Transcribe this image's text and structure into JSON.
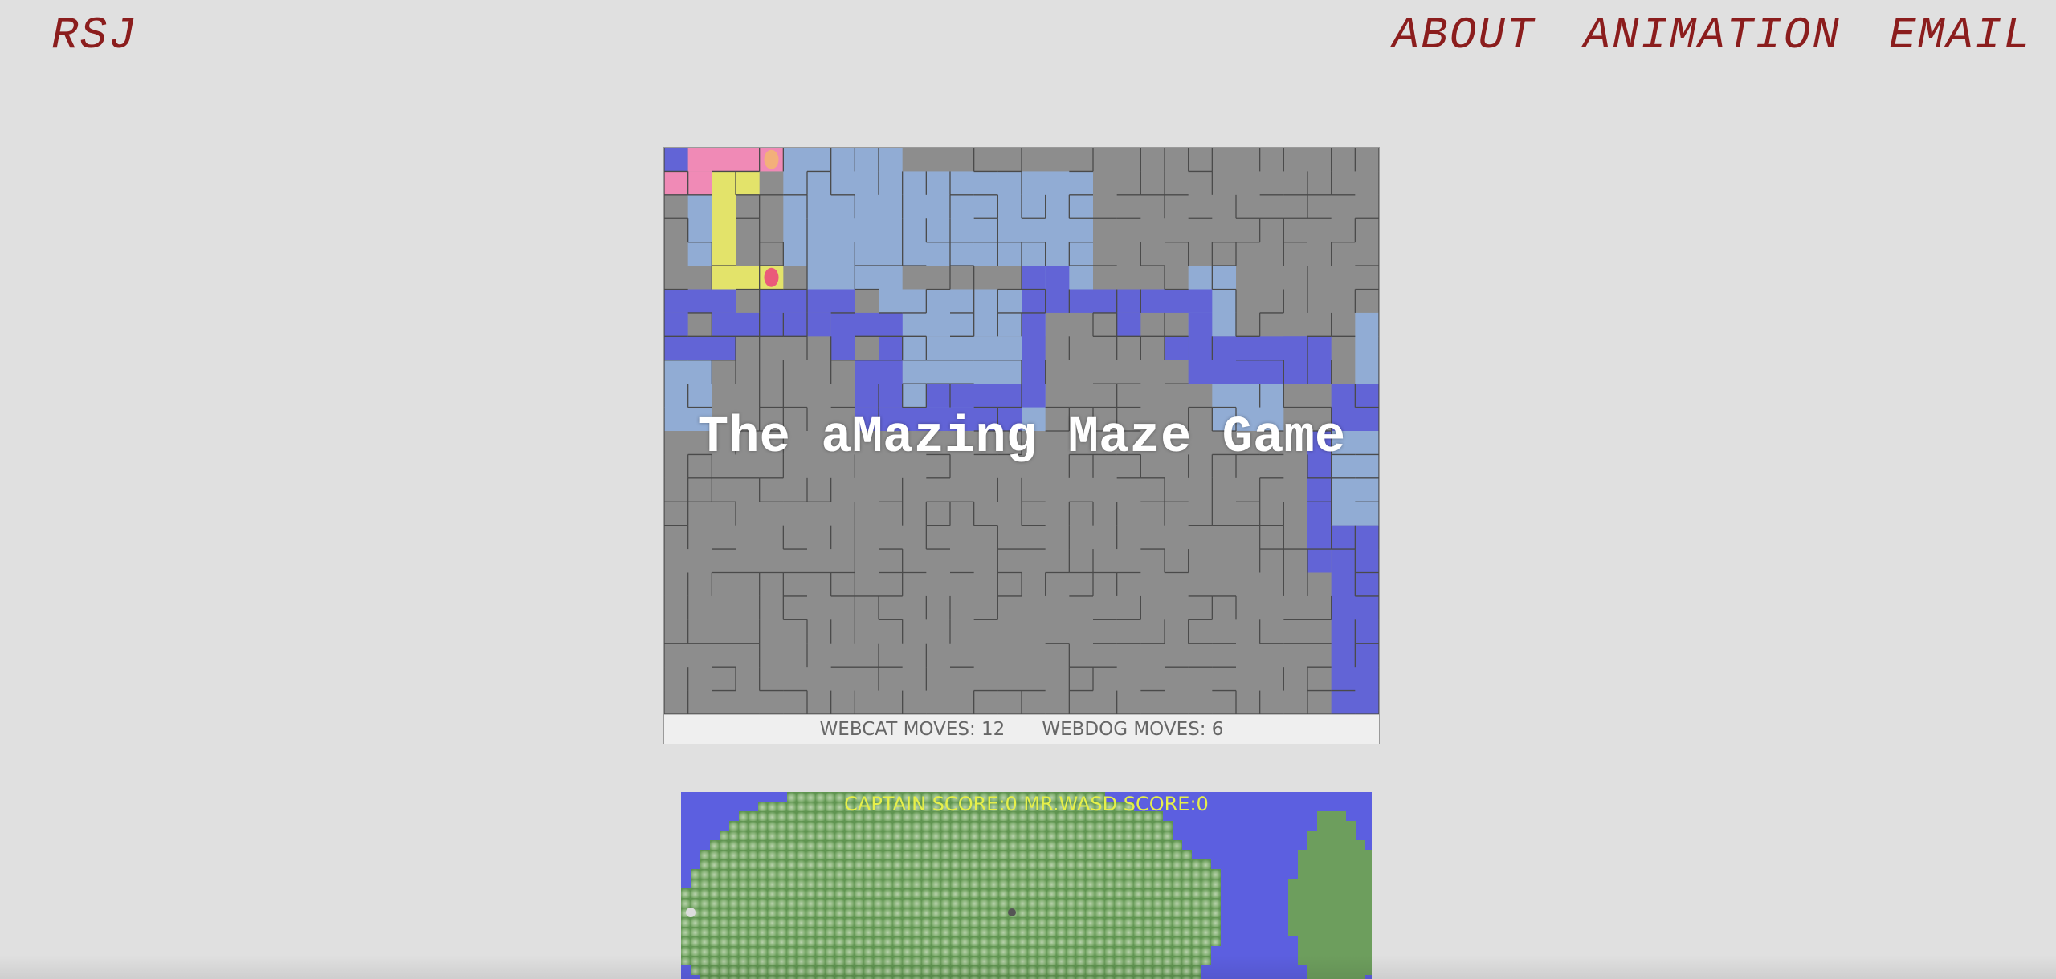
{
  "header": {
    "logo": "RSJ",
    "nav": [
      {
        "label": "ABOUT"
      },
      {
        "label": "ANIMATION"
      },
      {
        "label": "EMAIL"
      }
    ]
  },
  "maze_game": {
    "title": "The aMazing Maze Game",
    "webcat_moves": "WEBCAT MOVES: 12",
    "webdog_moves": "WEBDOG MOVES: 6",
    "colors": {
      "wall_floor": "#8d8d8d",
      "explored": "#91acd4",
      "path": "#6264d6",
      "player_pink": "#f08ab6",
      "player_yellow": "#e3e36a"
    }
  },
  "island_game": {
    "score_text": "CAPTAIN SCORE:0 MR.WASD SCORE:0",
    "colors": {
      "water": "#5c5fe0",
      "land": "#6d9e5d",
      "score": "#e6ef4a"
    }
  }
}
